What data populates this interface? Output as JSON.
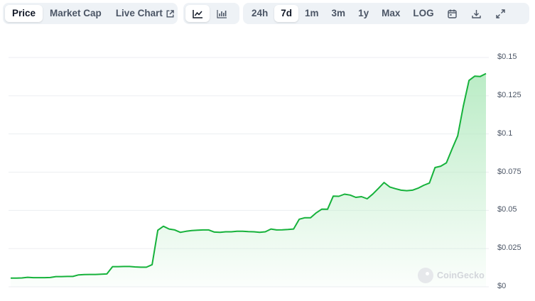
{
  "tabs": {
    "price": "Price",
    "market_cap": "Market Cap",
    "live_chart": "Live Chart"
  },
  "chart_style_buttons": {
    "active": "line-chart-icon",
    "items": [
      "line-chart-icon",
      "candlestick-icon"
    ]
  },
  "ranges": {
    "selected": "7d",
    "items": [
      "24h",
      "7d",
      "1m",
      "3m",
      "1y",
      "Max",
      "LOG"
    ]
  },
  "tool_icons": [
    "calendar-icon",
    "download-icon",
    "expand-icon"
  ],
  "watermark": "CoinGecko",
  "colors": {
    "line": "#16b23b",
    "fill_top": "#b7ebc3",
    "grid": "#eceef1",
    "active_tab_bg": "#ffffff",
    "toolbar_bg": "#eef2f6"
  },
  "chart_data": {
    "type": "area",
    "ylim": [
      0,
      0.15
    ],
    "yticks": [
      "$0",
      "$0.025",
      "$0.05",
      "$0.075",
      "$0.1",
      "$0.125",
      "$0.15"
    ],
    "ytick_values": [
      0,
      0.025,
      0.05,
      0.075,
      0.1,
      0.125,
      0.15
    ],
    "grid": true,
    "xlabel": "",
    "ylabel": "",
    "series": [
      {
        "values": [
          0.0057,
          0.0057,
          0.0058,
          0.0062,
          0.006,
          0.006,
          0.006,
          0.0061,
          0.0067,
          0.0067,
          0.0068,
          0.0068,
          0.0078,
          0.008,
          0.0081,
          0.0081,
          0.0082,
          0.0084,
          0.0132,
          0.0132,
          0.0133,
          0.0133,
          0.013,
          0.0128,
          0.0128,
          0.0145,
          0.037,
          0.0396,
          0.0378,
          0.0372,
          0.0356,
          0.0363,
          0.0368,
          0.037,
          0.0372,
          0.0372,
          0.0358,
          0.0356,
          0.036,
          0.036,
          0.0363,
          0.0363,
          0.0361,
          0.036,
          0.0356,
          0.036,
          0.0378,
          0.0372,
          0.0373,
          0.0375,
          0.0378,
          0.0442,
          0.0452,
          0.0452,
          0.0484,
          0.0508,
          0.0507,
          0.0593,
          0.0592,
          0.0606,
          0.06,
          0.0585,
          0.059,
          0.0576,
          0.0607,
          0.0644,
          0.0682,
          0.0653,
          0.0642,
          0.0632,
          0.0629,
          0.0632,
          0.0645,
          0.0664,
          0.0679,
          0.078,
          0.0789,
          0.0811,
          0.0901,
          0.0988,
          0.1182,
          0.135,
          0.1378,
          0.1376,
          0.1395
        ]
      }
    ]
  }
}
